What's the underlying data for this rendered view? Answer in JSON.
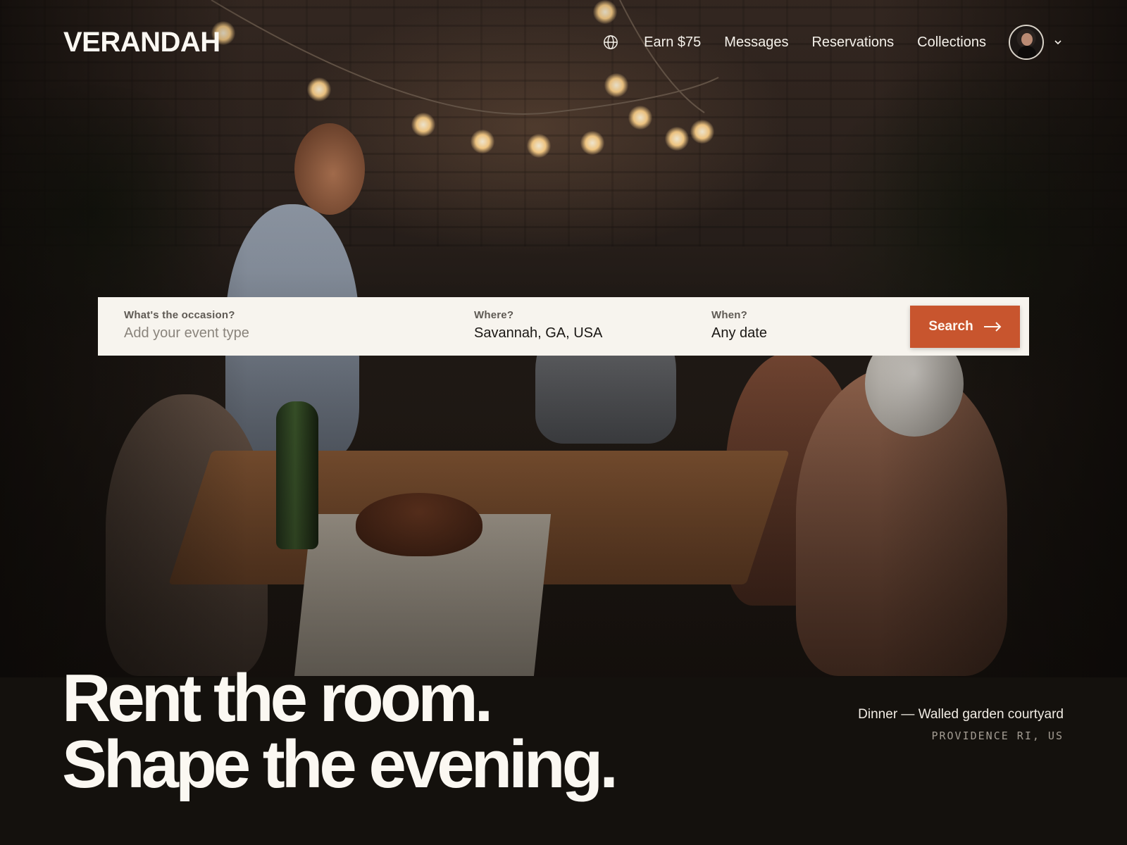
{
  "brand": {
    "name": "VERANDAH"
  },
  "nav": {
    "globe_icon": "globe-icon",
    "links": [
      {
        "label": "Earn $75"
      },
      {
        "label": "Messages"
      },
      {
        "label": "Reservations"
      },
      {
        "label": "Collections"
      }
    ],
    "user_menu_icon": "chevron-down-icon"
  },
  "search": {
    "occasion": {
      "label": "What's the occasion?",
      "placeholder": "Add your event type",
      "value": ""
    },
    "where": {
      "label": "Where?",
      "value": "Savannah, GA, USA"
    },
    "when": {
      "label": "When?",
      "value": "Any date"
    },
    "button": {
      "label": "Search",
      "icon": "arrow-right-icon"
    }
  },
  "hero": {
    "headline_line1": "Rent the room.",
    "headline_line2": "Shape the evening.",
    "caption_title": "Dinner — Walled garden courtyard",
    "caption_location": "PROVIDENCE RI, US"
  },
  "colors": {
    "accent": "#c8552e",
    "background": "#14110d",
    "search_bar": "#f7f4ee",
    "text_light": "#fbf8f2"
  }
}
